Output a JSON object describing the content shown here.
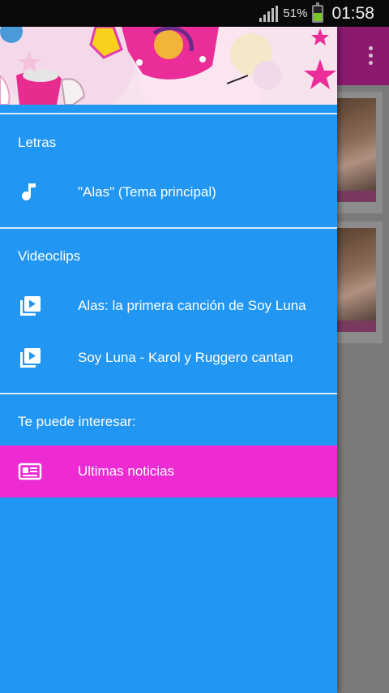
{
  "status_bar": {
    "battery_percent": "51%",
    "time": "01:58",
    "icons": [
      "signal-icon",
      "battery-icon"
    ],
    "battery_level": 0.51
  },
  "colors": {
    "drawer_bg": "#2196f3",
    "active_item_bg": "#ee2ad3",
    "app_bar": "#8b1a6f",
    "status_bar": "#0a0a0a"
  },
  "drawer": {
    "sections": [
      {
        "label": "Letras",
        "items": [
          {
            "label": "\"Alas\" (Tema principal)",
            "icon": "music-note-icon",
            "active": false
          }
        ]
      },
      {
        "label": "Videoclips",
        "items": [
          {
            "label": "Alas: la primera canción de Soy Luna",
            "icon": "video-library-icon",
            "active": false
          },
          {
            "label": "Soy Luna - Karol y Ruggero cantan",
            "icon": "video-library-icon",
            "active": false
          }
        ]
      },
      {
        "label": "Te puede interesar:",
        "items": [
          {
            "label": "Ultimas noticias",
            "icon": "newspaper-icon",
            "active": true
          }
        ]
      }
    ]
  }
}
